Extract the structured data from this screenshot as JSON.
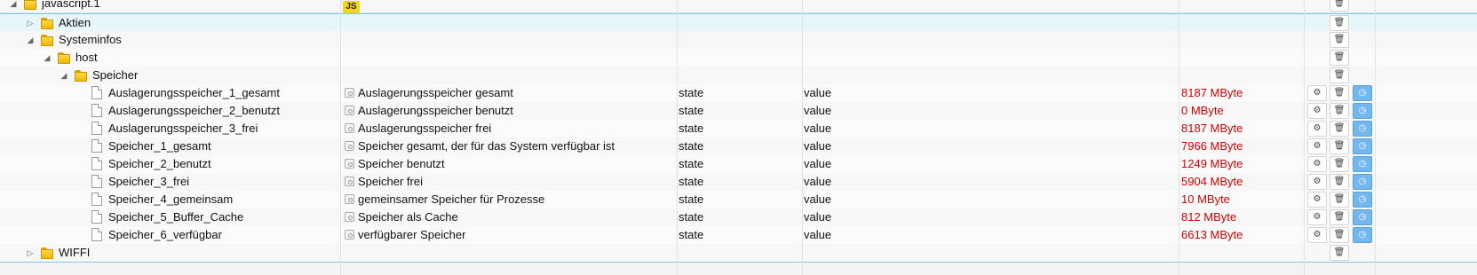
{
  "tree": {
    "root": {
      "name": "javascript.1",
      "badge": "JS"
    },
    "aktien": {
      "name": "Aktien"
    },
    "systeminfos": {
      "name": "Systeminfos"
    },
    "host": {
      "name": "host"
    },
    "speicher": {
      "name": "Speicher"
    },
    "wiffi": {
      "name": "WIFFI"
    }
  },
  "states": [
    {
      "name": "Auslagerungsspeicher_1_gesamt",
      "desc": "Auslagerungsspeicher gesamt",
      "type": "state",
      "role": "value",
      "value": "8187 MByte"
    },
    {
      "name": "Auslagerungsspeicher_2_benutzt",
      "desc": "Auslagerungsspeicher benutzt",
      "type": "state",
      "role": "value",
      "value": "0 MByte"
    },
    {
      "name": "Auslagerungsspeicher_3_frei",
      "desc": "Auslagerungsspeicher frei",
      "type": "state",
      "role": "value",
      "value": "8187 MByte"
    },
    {
      "name": "Speicher_1_gesamt",
      "desc": "Speicher gesamt, der für das System verfügbar ist",
      "type": "state",
      "role": "value",
      "value": "7966 MByte"
    },
    {
      "name": "Speicher_2_benutzt",
      "desc": "Speicher benutzt",
      "type": "state",
      "role": "value",
      "value": "1249 MByte"
    },
    {
      "name": "Speicher_3_frei",
      "desc": "Speicher frei",
      "type": "state",
      "role": "value",
      "value": "5904 MByte"
    },
    {
      "name": "Speicher_4_gemeinsam",
      "desc": "gemeinsamer Speicher für Prozesse",
      "type": "state",
      "role": "value",
      "value": "10 MByte"
    },
    {
      "name": "Speicher_5_Buffer_Cache",
      "desc": "Speicher als Cache",
      "type": "state",
      "role": "value",
      "value": "812 MByte"
    },
    {
      "name": "Speicher_6_verfügbar",
      "desc": "verfügbarer Speicher",
      "type": "state",
      "role": "value",
      "value": "6613 MByte"
    }
  ],
  "icons": {
    "expanded": "triangle-down-icon",
    "collapsed": "triangle-right-icon",
    "folder": "folder-icon",
    "file": "file-icon",
    "settings": "gear-icon",
    "delete": "trash-icon",
    "history": "clock-icon"
  },
  "colors": {
    "value_text": "#d00000",
    "history_button": "#73b7f0",
    "selection": "#e6f6fb",
    "js_badge": "#f3d51b"
  }
}
